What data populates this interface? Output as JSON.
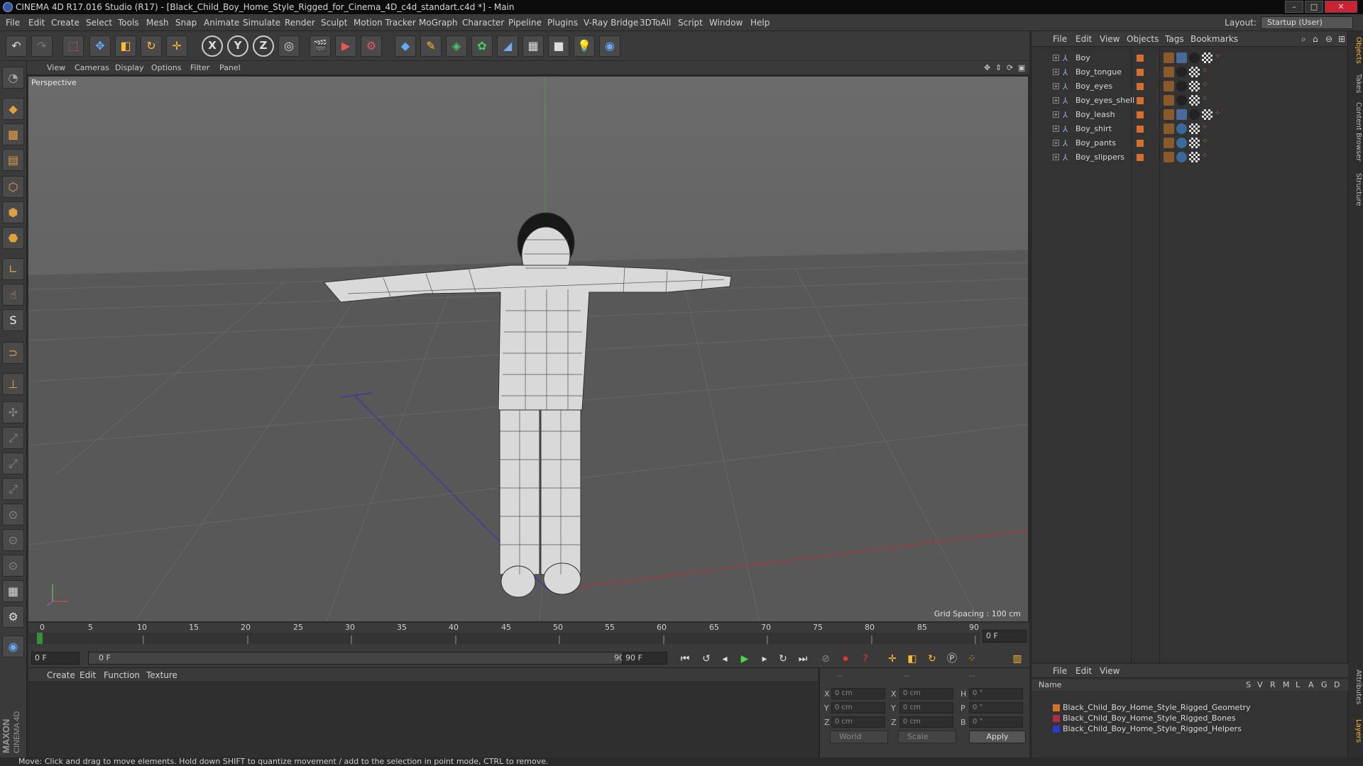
{
  "window": {
    "title": "CINEMA 4D R17.016 Studio (R17) - [Black_Child_Boy_Home_Style_Rigged_for_Cinema_4D_c4d_standart.c4d *] - Main"
  },
  "menu": [
    "File",
    "Edit",
    "Create",
    "Select",
    "Tools",
    "Mesh",
    "Snap",
    "Animate",
    "Simulate",
    "Render",
    "Sculpt",
    "Motion Tracker",
    "MoGraph",
    "Character",
    "Pipeline",
    "Plugins",
    "V-Ray Bridge",
    "3DToAll",
    "Script",
    "Window",
    "Help"
  ],
  "layout": {
    "label": "Layout:",
    "value": "Startup (User)"
  },
  "viewport": {
    "menu": [
      "View",
      "Cameras",
      "Display",
      "Options",
      "Filter",
      "Panel"
    ],
    "camera": "Perspective",
    "grid_spacing": "Grid Spacing : 100 cm"
  },
  "timeline": {
    "ticks": [
      "0",
      "5",
      "10",
      "15",
      "20",
      "25",
      "30",
      "35",
      "40",
      "45",
      "50",
      "55",
      "60",
      "65",
      "70",
      "75",
      "80",
      "85",
      "90"
    ],
    "current_frame": "0 F",
    "start": "0 F",
    "range_start": "0 F",
    "range_end": "90 F",
    "end": "90 F"
  },
  "material_panel": {
    "menu": [
      "Create",
      "Edit",
      "Function",
      "Texture"
    ]
  },
  "coords": {
    "x_pos": "0 cm",
    "y_pos": "0 cm",
    "z_pos": "0 cm",
    "x_size": "0 cm",
    "y_size": "0 cm",
    "z_size": "0 cm",
    "h": "0 °",
    "p": "0 °",
    "b": "0 °",
    "labels": {
      "x": "X",
      "y": "Y",
      "z": "Z",
      "h": "H",
      "p": "P",
      "b": "B"
    },
    "world": "World",
    "scale": "Scale",
    "apply": "Apply",
    "dashes": "--"
  },
  "object_manager": {
    "menu": [
      "File",
      "Edit",
      "View",
      "Objects",
      "Tags",
      "Bookmarks"
    ],
    "objects": [
      "Boy",
      "Boy_tongue",
      "Boy_eyes",
      "Boy_eyes_shell",
      "Boy_leash",
      "Boy_shirt",
      "Boy_pants",
      "Boy_slippers"
    ]
  },
  "side_tabs": [
    "Objects",
    "Takes",
    "Content Browser",
    "Structure",
    "Attributes",
    "Layers"
  ],
  "layer_manager": {
    "menu": [
      "File",
      "Edit",
      "View"
    ],
    "columns": [
      "Name",
      "S",
      "V",
      "R",
      "M",
      "L",
      "A",
      "G",
      "D"
    ],
    "layers": [
      {
        "name": "Black_Child_Boy_Home_Style_Rigged_Geometry",
        "color": "#d96d2a"
      },
      {
        "name": "Black_Child_Boy_Home_Style_Rigged_Bones",
        "color": "#b02a4a"
      },
      {
        "name": "Black_Child_Boy_Home_Style_Rigged_Helpers",
        "color": "#2a3ad0"
      }
    ]
  },
  "status": "Move: Click and drag to move elements. Hold down SHIFT to quantize movement / add to the selection in point mode, CTRL to remove.",
  "brand": {
    "maxon": "MAXON",
    "cinema": "CINEMA 4D"
  }
}
